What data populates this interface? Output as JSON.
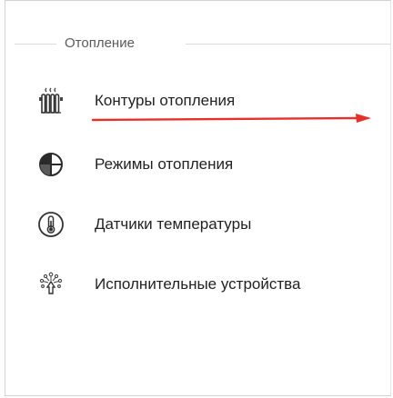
{
  "section": {
    "title": "Отопление"
  },
  "menu": {
    "items": [
      {
        "label": "Контуры отопления",
        "icon": "radiator-icon"
      },
      {
        "label": "Режимы отопления",
        "icon": "heating-mode-icon"
      },
      {
        "label": "Датчики температуры",
        "icon": "thermometer-icon"
      },
      {
        "label": "Исполнительные устройства",
        "icon": "actuator-icon"
      }
    ]
  },
  "colors": {
    "annotation_arrow": "#e8302a",
    "icon_stroke": "#444444",
    "icon_accent": "#2a2a2a"
  }
}
